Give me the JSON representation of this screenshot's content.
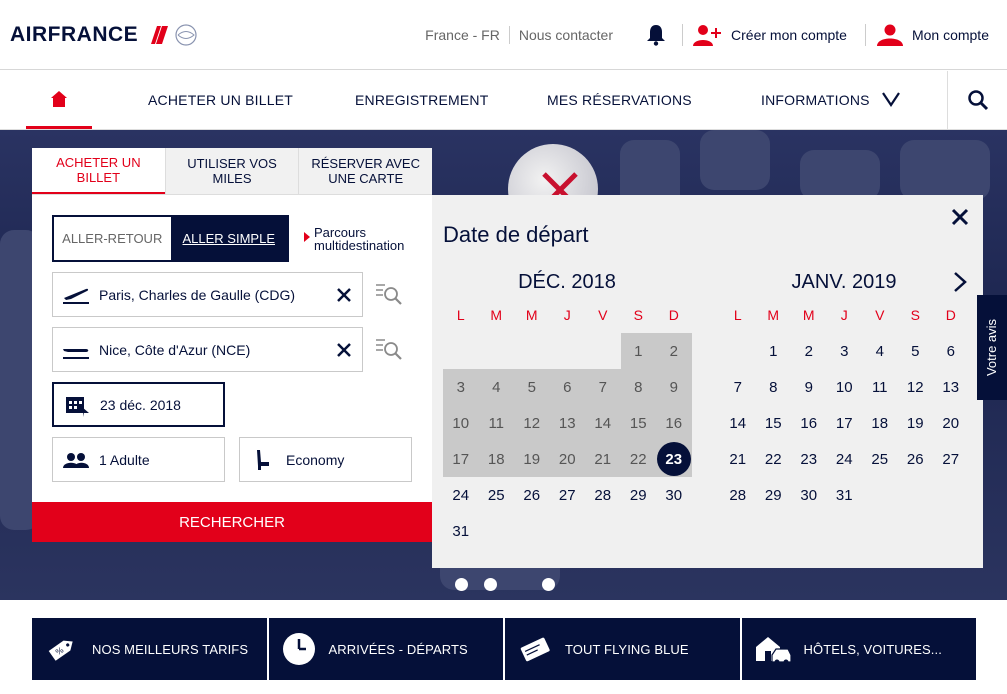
{
  "brand": {
    "name_left": "AIR",
    "name_right": "FRANCE",
    "primary": "#051039",
    "accent": "#e2001a"
  },
  "top_links": {
    "locale": "France - FR",
    "contact": "Nous contacter",
    "create_account": "Créer mon compte",
    "my_account": "Mon compte"
  },
  "nav": {
    "items": [
      "ACHETER UN BILLET",
      "ENREGISTREMENT",
      "MES RÉSERVATIONS",
      "INFORMATIONS"
    ]
  },
  "booking": {
    "tabs": [
      "ACHETER UN BILLET",
      "UTILISER VOS MILES",
      "RÉSERVER AVEC UNE CARTE"
    ],
    "trip_options": [
      "ALLER-RETOUR",
      "ALLER SIMPLE"
    ],
    "multi": "Parcours multidestination",
    "origin": "Paris, Charles de Gaulle (CDG)",
    "destination": "Nice, Côte d'Azur (NCE)",
    "date": "23 déc. 2018",
    "passengers": "1 Adulte",
    "cabin": "Economy",
    "search_label": "RECHERCHER"
  },
  "calendar": {
    "title": "Date de départ",
    "dow": [
      "L",
      "M",
      "M",
      "J",
      "V",
      "S",
      "D"
    ],
    "months": [
      {
        "name": "DÉC. 2018",
        "offset": 5,
        "days": 31,
        "past_until": 22,
        "selected": 23
      },
      {
        "name": "JANV. 2019",
        "offset": 1,
        "days": 31,
        "past_until": 0,
        "selected": 0
      }
    ]
  },
  "feedback": "Votre avis",
  "tiles": [
    {
      "label": "NOS MEILLEURS TARIFS",
      "icon": "price-tag-icon"
    },
    {
      "label": "ARRIVÉES - DÉPARTS",
      "icon": "clock-icon"
    },
    {
      "label": "TOUT FLYING BLUE",
      "icon": "flying-blue-card-icon"
    },
    {
      "label": "HÔTELS, VOITURES...",
      "icon": "hotel-car-icon"
    }
  ]
}
